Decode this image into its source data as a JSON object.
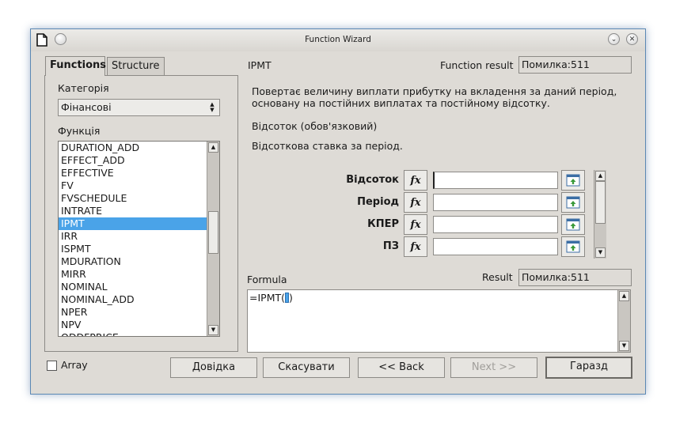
{
  "window": {
    "title": "Function Wizard"
  },
  "tabs": [
    "Functions",
    "Structure"
  ],
  "left": {
    "category_label": "Категорія",
    "category_value": "Фінансові",
    "function_label": "Функція",
    "functions": [
      "DURATION_ADD",
      "EFFECT_ADD",
      "EFFECTIVE",
      "FV",
      "FVSCHEDULE",
      "INTRATE",
      "IPMT",
      "IRR",
      "ISPMT",
      "MDURATION",
      "MIRR",
      "NOMINAL",
      "NOMINAL_ADD",
      "NPER",
      "NPV",
      "ODDFPRICE"
    ],
    "selected_function": "IPMT"
  },
  "right": {
    "function_name": "IPMT",
    "function_result_label": "Function result",
    "function_result_value": "Помилка:511",
    "description": "Повертає величину виплати прибутку на вкладення за даний період, основану на постійних виплатах та постійному відсотку.",
    "arg_title": "Відсоток (обов'язковий)",
    "arg_description": "Відсоткова ставка за період.",
    "args": [
      {
        "label": "Відсоток",
        "value": ""
      },
      {
        "label": "Період",
        "value": ""
      },
      {
        "label": "КПЕР",
        "value": ""
      },
      {
        "label": "ПЗ",
        "value": ""
      }
    ],
    "fx_label": "fx",
    "formula_label": "Formula",
    "result_label": "Result",
    "result_value": "Помилка:511",
    "formula_prefix": "=IPMT(",
    "formula_suffix": ")"
  },
  "footer": {
    "array_label": "Array",
    "help": "Довідка",
    "cancel": "Скасувати",
    "back": "<< Back",
    "next": "Next >>",
    "ok": "Гаразд"
  }
}
